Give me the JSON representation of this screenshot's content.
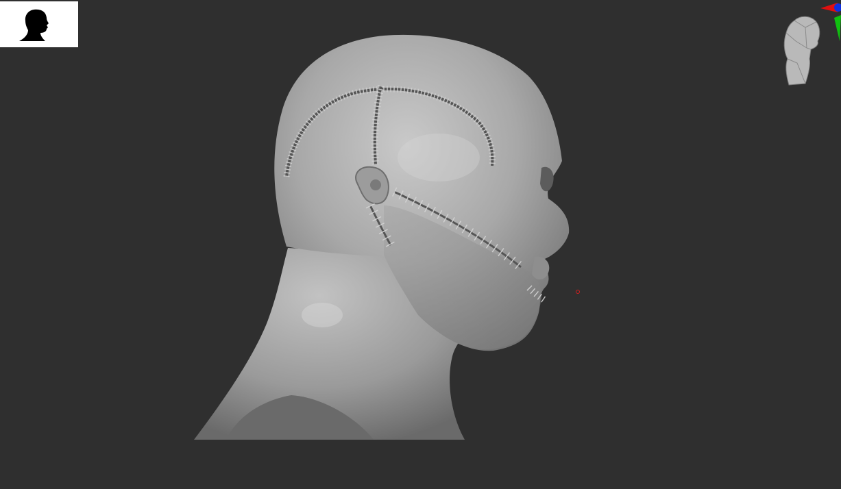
{
  "viewport": {
    "background": "#2f2f2f",
    "model_material_color": "#9e9e9e"
  },
  "thumbnail": {
    "icon": "head-silhouette-icon",
    "background": "#ffffff",
    "fill": "#000000"
  },
  "navigator": {
    "icon": "navigation-cube-head-icon",
    "axes": [
      {
        "name": "x-axis",
        "color": "#e01010"
      },
      {
        "name": "y-axis",
        "color": "#10c010"
      },
      {
        "name": "z-axis",
        "color": "#1030e0"
      }
    ]
  },
  "cursor": {
    "icon": "brush-cursor-icon",
    "color": "#d02020"
  }
}
